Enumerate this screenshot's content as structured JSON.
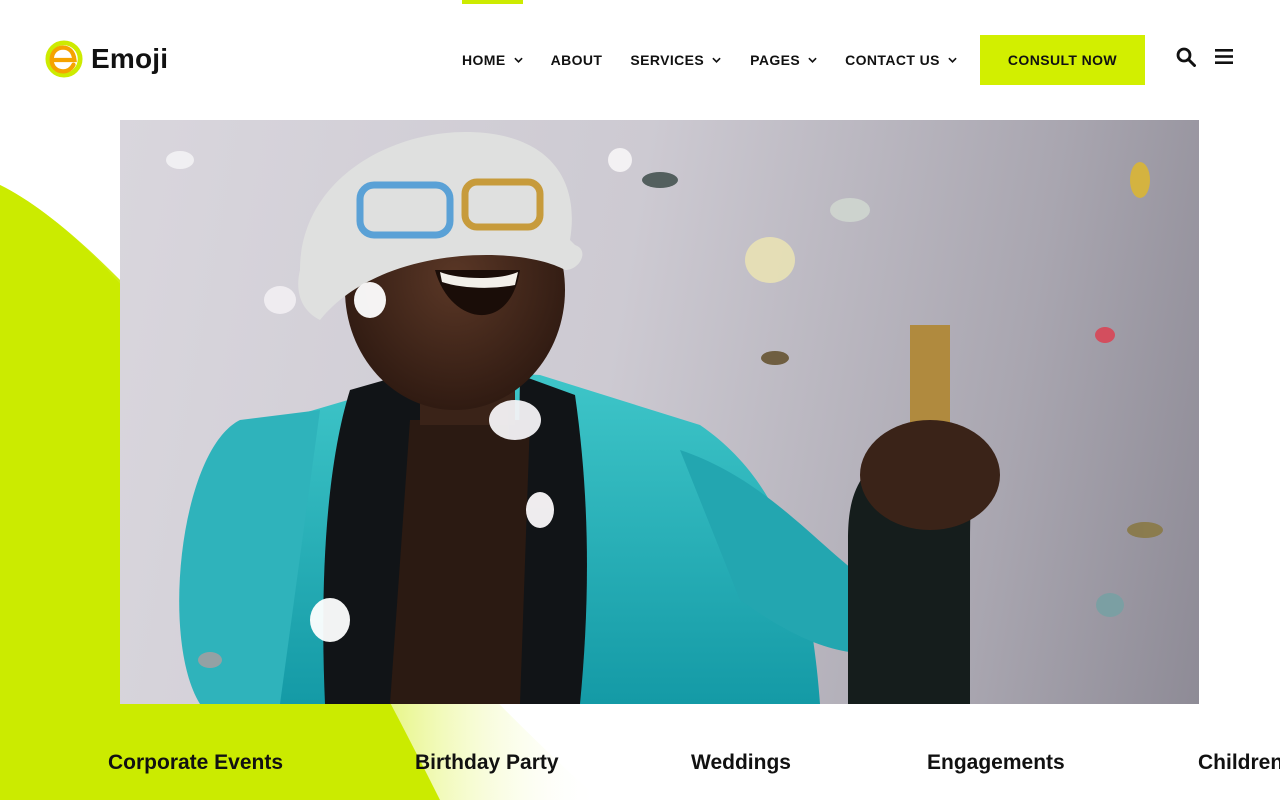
{
  "brand": {
    "name": "Emoji",
    "accent": "#cdeb00"
  },
  "nav": {
    "items": [
      {
        "label": "HOME",
        "dropdown": true
      },
      {
        "label": "ABOUT",
        "dropdown": false
      },
      {
        "label": "SERVICES",
        "dropdown": true
      },
      {
        "label": "PAGES",
        "dropdown": true
      },
      {
        "label": "CONTACT US",
        "dropdown": true
      }
    ],
    "active": "HOME",
    "cta_label": "CONSULT NOW",
    "search_icon": "search-icon",
    "menu_icon": "hamburger-menu-icon"
  },
  "categories": [
    "Corporate Events",
    "Birthday Party",
    "Weddings",
    "Engagements",
    "Children"
  ]
}
